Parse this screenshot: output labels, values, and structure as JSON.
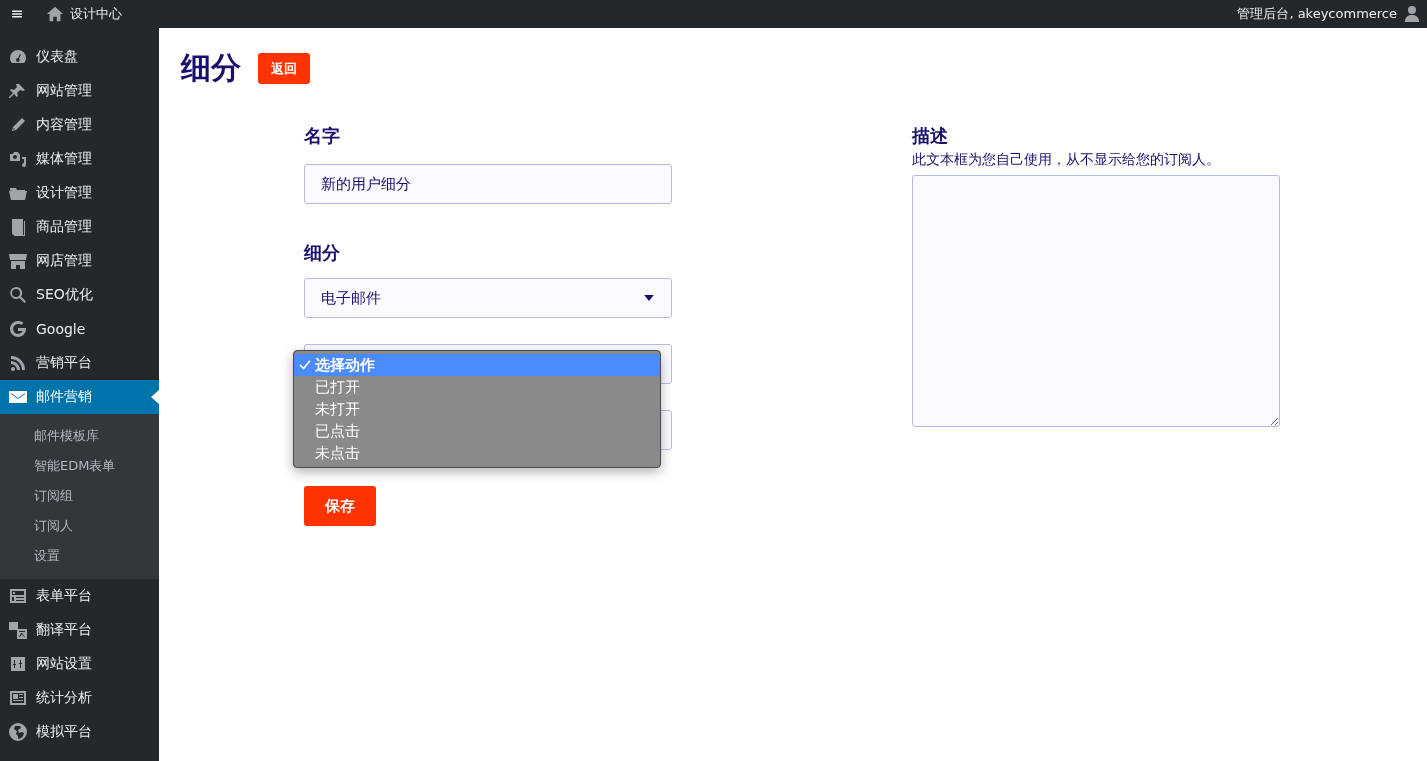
{
  "topbar": {
    "site_title": "设计中心",
    "account": "管理后台, akeycommerce"
  },
  "sidebar": {
    "items": [
      {
        "label": "仪表盘",
        "selected": false
      },
      {
        "label": "网站管理",
        "selected": false
      },
      {
        "label": "内容管理",
        "selected": false
      },
      {
        "label": "媒体管理",
        "selected": false
      },
      {
        "label": "设计管理",
        "selected": false
      },
      {
        "label": "商品管理",
        "selected": false
      },
      {
        "label": "网店管理",
        "selected": false
      },
      {
        "label": "SEO优化",
        "selected": false
      },
      {
        "label": "Google",
        "selected": false
      },
      {
        "label": "营销平台",
        "selected": false
      },
      {
        "label": "邮件营销",
        "selected": true,
        "children": [
          {
            "label": "邮件模板库",
            "selected": false
          },
          {
            "label": "智能EDM表单",
            "selected": false
          },
          {
            "label": "订阅组",
            "selected": false
          },
          {
            "label": "订阅人",
            "selected": false
          },
          {
            "label": "设置",
            "selected": false
          }
        ]
      },
      {
        "label": "表单平台",
        "selected": false
      },
      {
        "label": "翻译平台",
        "selected": false
      },
      {
        "label": "网站设置",
        "selected": false
      },
      {
        "label": "统计分析",
        "selected": false
      },
      {
        "label": "模拟平台",
        "selected": false
      }
    ]
  },
  "page": {
    "title": "细分",
    "back_button": "返回"
  },
  "form": {
    "name_label": "名字",
    "name_value": "新的用户细分",
    "segment_label": "细分",
    "segment_value": "电子邮件",
    "action_options": [
      {
        "label": "选择动作",
        "selected": true
      },
      {
        "label": "已打开",
        "selected": false
      },
      {
        "label": "未打开",
        "selected": false
      },
      {
        "label": "已点击",
        "selected": false
      },
      {
        "label": "未点击",
        "selected": false
      }
    ],
    "save_button": "保存"
  },
  "description": {
    "label": "描述",
    "hint": "此文本框为您自己使用，从不显示给您的订阅人。"
  }
}
